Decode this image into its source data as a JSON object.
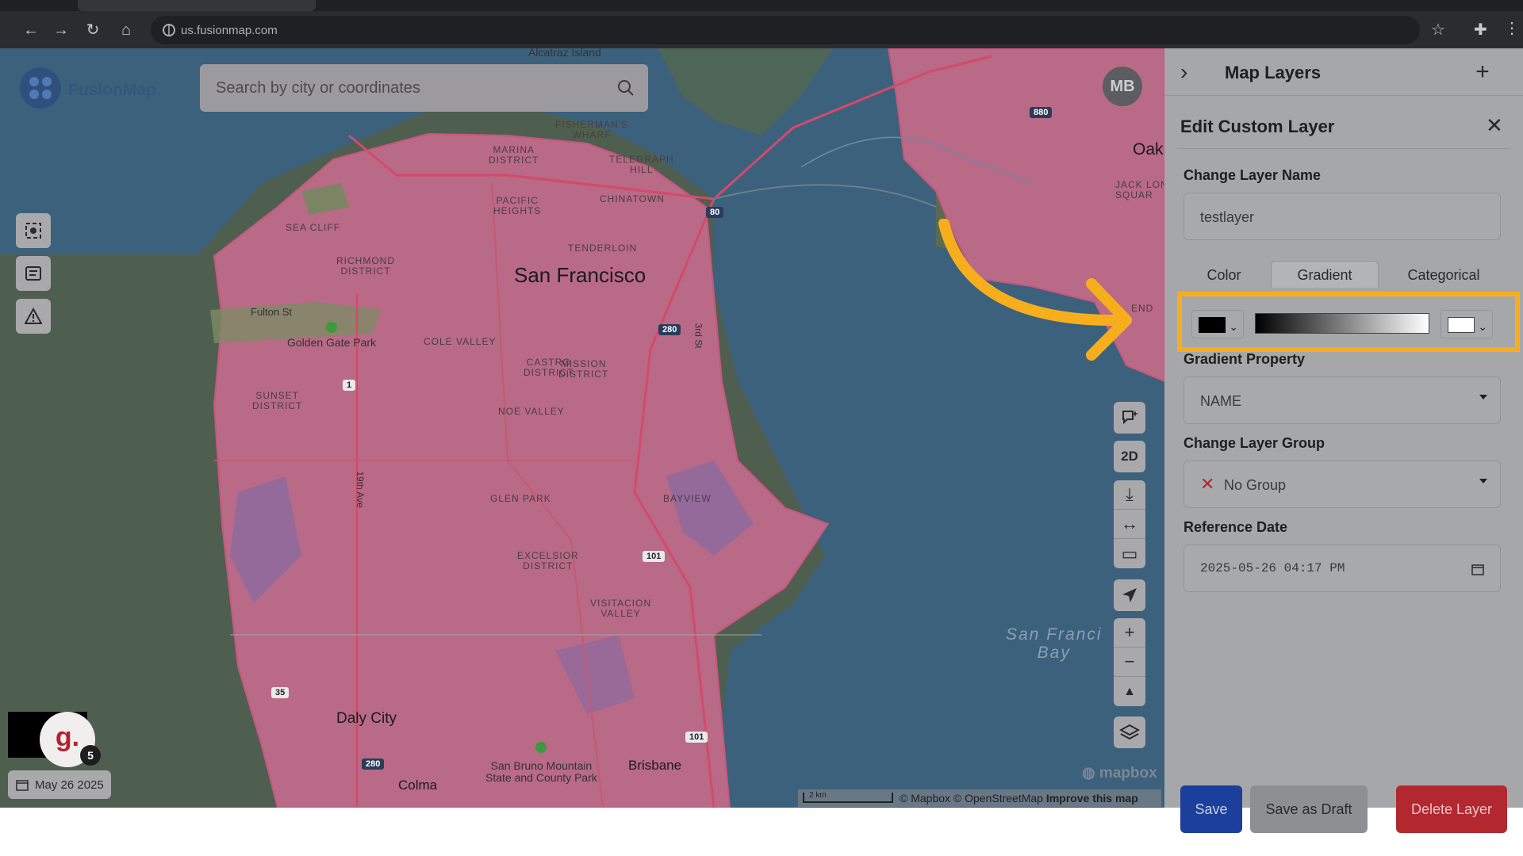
{
  "browser": {
    "url": "us.fusionmap.com"
  },
  "app": {
    "logo_text": "FusionMap",
    "user_initials": "MB"
  },
  "search": {
    "placeholder": "Search by city or coordinates"
  },
  "map": {
    "labels": {
      "alcatraz": "Alcatraz Island",
      "fishermans": "FISHERMAN'S\nWHARF",
      "marina": "MARINA\nDISTRICT",
      "telegraph": "TELEGRAPH\nHILL",
      "pacific": "PACIFIC\nHEIGHTS",
      "chinatown": "CHINATOWN",
      "seacliff": "SEA CLIFF",
      "tenderloin": "TENDERLOIN",
      "richmond": "RICHMOND\nDISTRICT",
      "sf": "San Francisco",
      "fulton": "Fulton St",
      "ggpark": "Golden Gate Park",
      "colevalley": "COLE VALLEY",
      "castro": "CASTRO\nDISTRICT",
      "mission": "MISSION\nDISTRICT",
      "sunset": "SUNSET\nDISTRICT",
      "noe": "NOE VALLEY",
      "glenpark": "GLEN PARK",
      "bayview": "BAYVIEW",
      "excelsior": "EXCELSIOR\nDISTRICT",
      "visitacion": "VISITACION\nVALLEY",
      "daly": "Daly City",
      "sanbruno": "San Bruno Mountain\nState and County Park",
      "brisbane": "Brisbane",
      "colma": "Colma",
      "oak": "Oak",
      "jacklondon": "JACK LON\nSQUAR",
      "sfbay": "San Franci\nBay",
      "third": "3rd St",
      "ave19": "19th Ave",
      "end": "END"
    },
    "shields": {
      "r80a": "80",
      "r80b": "80",
      "r280a": "280",
      "r280b": "280",
      "r101a": "101",
      "r101b": "101",
      "r1": "1",
      "r35": "35",
      "r880": "880"
    },
    "controls": {
      "mode_2d": "2D"
    },
    "date_chip": "May 26 2025",
    "notification": {
      "letter": "g.",
      "count": "5"
    },
    "scale": "2 km",
    "attribution": {
      "text": "© Mapbox © OpenStreetMap",
      "link": "Improve this map"
    },
    "mapbox_logo": "mapbox"
  },
  "panel": {
    "header_title": "Map Layers",
    "edit_title": "Edit Custom Layer",
    "layer_name_label": "Change Layer Name",
    "layer_name_value": "testlayer",
    "tabs": [
      "Color",
      "Gradient",
      "Categorical"
    ],
    "active_tab": "Gradient",
    "gradient": {
      "start_color": "#000000",
      "end_color": "#ffffff"
    },
    "gradient_property_label": "Gradient Property",
    "gradient_property_value": "NAME",
    "group_label": "Change Layer Group",
    "group_value": "No Group",
    "date_label": "Reference Date",
    "date_value": "2025-05-26 04:17 PM",
    "buttons": {
      "save": "Save",
      "draft": "Save as Draft",
      "delete": "Delete Layer"
    }
  },
  "colors": {
    "highlight": "#f7ae1d",
    "save": "#1b3f9b",
    "delete": "#b3272f",
    "layer_fill": "#b86a86"
  }
}
